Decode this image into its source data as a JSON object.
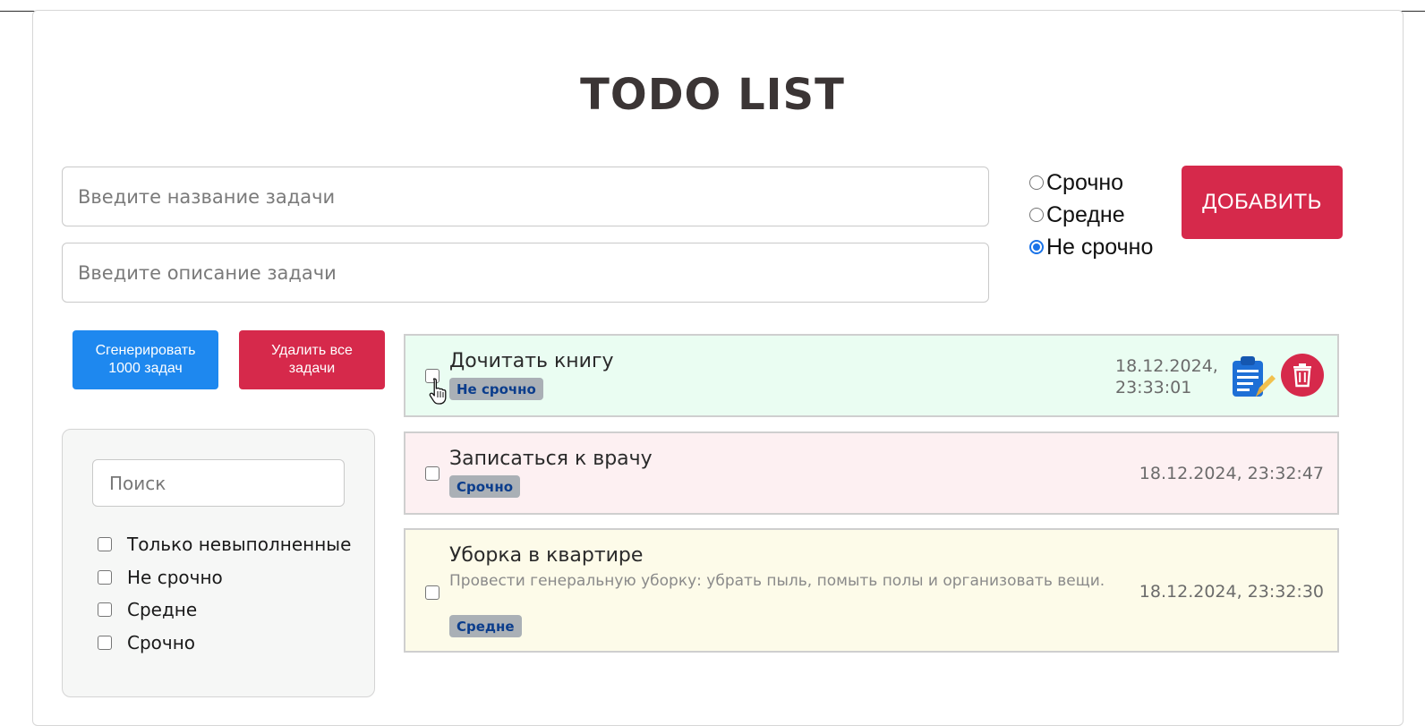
{
  "app": {
    "title": "TODO LIST"
  },
  "form": {
    "title_placeholder": "Введите название задачи",
    "description_placeholder": "Введите описание задачи",
    "priority_options": [
      {
        "label": "Срочно",
        "selected": false
      },
      {
        "label": "Средне",
        "selected": false
      },
      {
        "label": "Не срочно",
        "selected": true
      }
    ],
    "add_label": "ДОБАВИТЬ"
  },
  "actions": {
    "generate_label": "Сгенерировать 1000 задач",
    "delete_all_label": "Удалить все задачи"
  },
  "filters": {
    "search_placeholder": "Поиск",
    "options": [
      {
        "label": "Только невыполненные",
        "checked": false
      },
      {
        "label": "Не срочно",
        "checked": false
      },
      {
        "label": "Средне",
        "checked": false
      },
      {
        "label": "Срочно",
        "checked": false
      }
    ]
  },
  "tasks": [
    {
      "title": "Дочитать книгу",
      "description": "",
      "priority": "Не срочно",
      "date": "18.12.2024, 23:33:01",
      "done": false,
      "hovered": true,
      "bg_color": "#eafdf2"
    },
    {
      "title": "Записаться к врачу",
      "description": "",
      "priority": "Срочно",
      "date": "18.12.2024, 23:32:47",
      "done": false,
      "hovered": false,
      "bg_color": "#fdf0f2"
    },
    {
      "title": "Уборка в квартире",
      "description": "Провести генеральную уборку: убрать пыль, помыть полы и организовать вещи.",
      "priority": "Средне",
      "date": "18.12.2024, 23:32:30",
      "done": false,
      "hovered": false,
      "bg_color": "#fdfbe9"
    }
  ],
  "icons": {
    "edit": "clipboard-pencil-icon",
    "delete": "trash-icon",
    "cursor": "hand-pointer-icon"
  },
  "colors": {
    "accent_red": "#d6294b",
    "accent_blue": "#1e88ef",
    "badge_bg": "#aab0b6",
    "badge_text": "#0b3d8c"
  }
}
